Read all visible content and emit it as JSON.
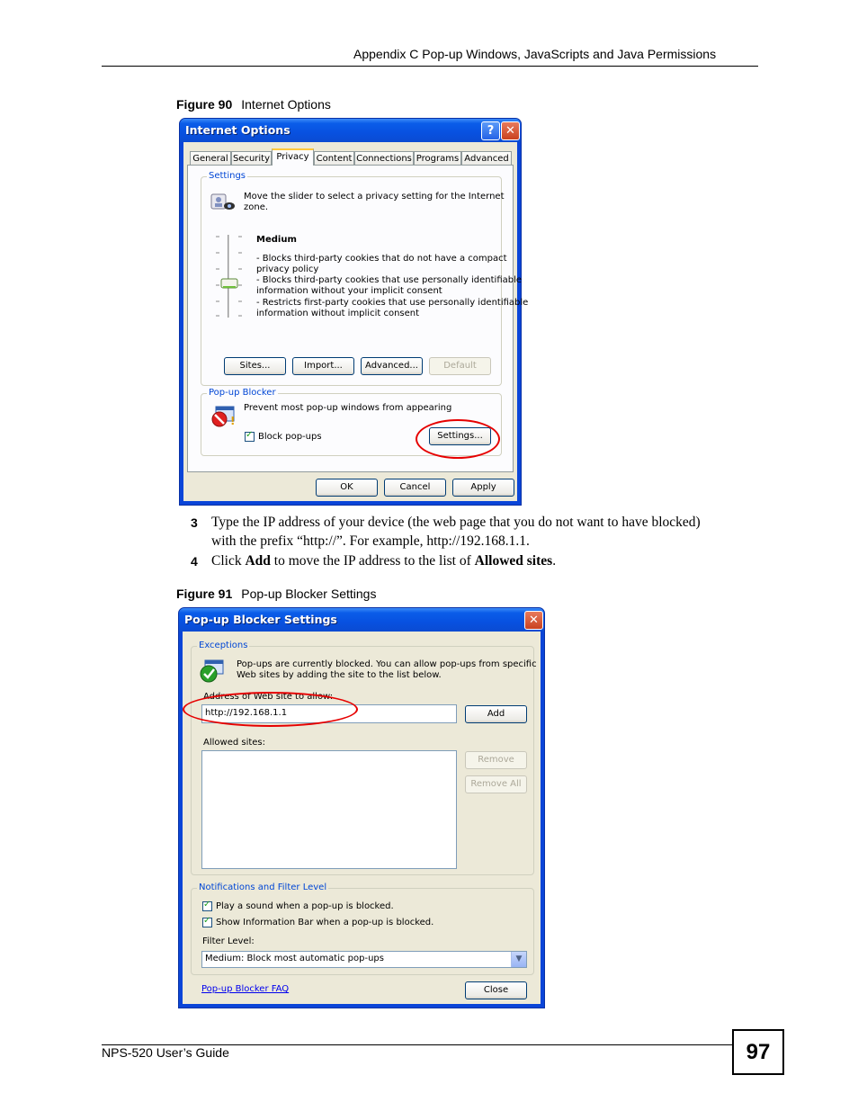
{
  "header": {
    "title": "Appendix C Pop-up Windows, JavaScripts and Java Permissions"
  },
  "figure90": {
    "number": "Figure 90",
    "caption": "Internet Options",
    "dialog": {
      "title": "Internet Options",
      "tabs": [
        "General",
        "Security",
        "Privacy",
        "Content",
        "Connections",
        "Programs",
        "Advanced"
      ],
      "active_tab": "Privacy",
      "settings": {
        "label": "Settings",
        "intro_line1": "Move the slider to select a privacy setting for the Internet",
        "intro_line2": "zone.",
        "level": "Medium",
        "desc": [
          "- Blocks third-party cookies that do not have a compact",
          "privacy policy",
          "- Blocks third-party cookies that use personally identifiable",
          "information without your implicit consent",
          "- Restricts first-party cookies that use personally identifiable",
          "information without implicit consent"
        ],
        "buttons": {
          "sites": "Sites...",
          "import": "Import...",
          "advanced": "Advanced...",
          "default": "Default"
        }
      },
      "popup": {
        "label": "Pop-up Blocker",
        "description": "Prevent most pop-up windows from appearing",
        "checkbox_label": "Block pop-ups",
        "settings_button": "Settings..."
      },
      "footer": {
        "ok": "OK",
        "cancel": "Cancel",
        "apply": "Apply"
      }
    }
  },
  "steps": {
    "s3": {
      "num": "3",
      "line1": "Type the IP address of your device (the web page that you do not want to have blocked)",
      "line2": "with the prefix “http://”. For example, http://192.168.1.1."
    },
    "s4": {
      "num": "4",
      "pre": "Click ",
      "add": "Add",
      "mid": " to move the IP address to the list of ",
      "allowed": "Allowed sites",
      "end": "."
    }
  },
  "figure91": {
    "number": "Figure 91",
    "caption": "Pop-up Blocker Settings",
    "dialog": {
      "title": "Pop-up Blocker Settings",
      "exceptions": {
        "label": "Exceptions",
        "info_line1": "Pop-ups are currently blocked.  You can allow pop-ups from specific",
        "info_line2": "Web sites by adding the site to the list below.",
        "address_label": "Address of Web site to allow:",
        "address_value": "http://192.168.1.1",
        "add": "Add",
        "allowed_label": "Allowed sites:",
        "remove": "Remove",
        "remove_all": "Remove All"
      },
      "notifications": {
        "label": "Notifications and Filter Level",
        "sound": "Play a sound when a pop-up is blocked.",
        "infobar": "Show Information Bar when a pop-up is blocked.",
        "filter_label": "Filter Level:",
        "filter_value": "Medium: Block most automatic pop-ups"
      },
      "faq_link": "Pop-up Blocker FAQ",
      "close": "Close"
    }
  },
  "footer": {
    "guide": "NPS-520 User’s Guide",
    "page": "97"
  }
}
